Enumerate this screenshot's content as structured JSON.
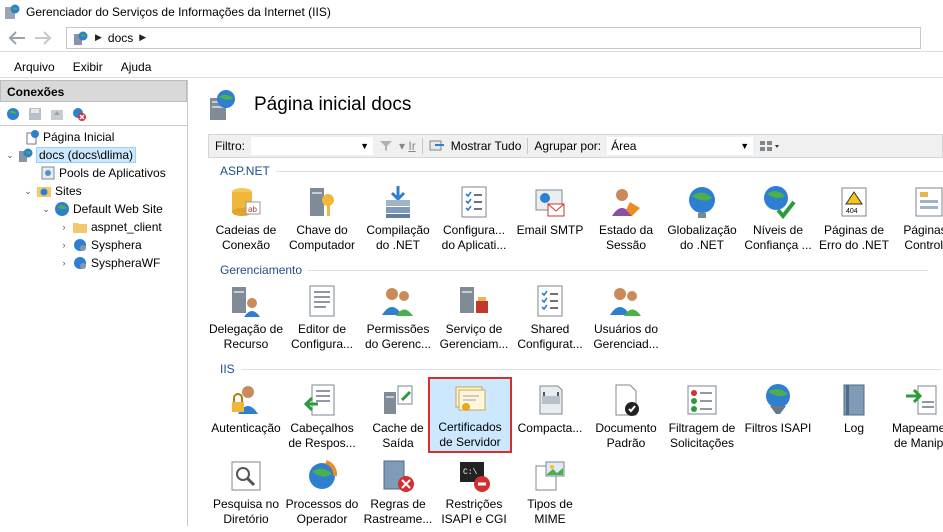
{
  "window": {
    "title": "Gerenciador do Serviços de Informações da Internet (IIS)"
  },
  "address": {
    "crumbs": [
      "docs"
    ]
  },
  "menu": {
    "items": [
      "Arquivo",
      "Exibir",
      "Ajuda"
    ]
  },
  "connections": {
    "title": "Conexões",
    "tree": [
      {
        "label": "Página Inicial"
      },
      {
        "label": "docs (docs\\dlima)"
      },
      {
        "label": "Pools de Aplicativos"
      },
      {
        "label": "Sites"
      },
      {
        "label": "Default Web Site"
      },
      {
        "label": "aspnet_client"
      },
      {
        "label": "Sysphera"
      },
      {
        "label": "SyspheraWF"
      }
    ]
  },
  "main": {
    "title": "Página inicial docs",
    "filter": {
      "label": "Filtro:",
      "go": "Ir",
      "show_all": "Mostrar Tudo",
      "group_by": "Agrupar por:",
      "group_value": "Área"
    },
    "groups": [
      {
        "name": "ASP.NET",
        "features": [
          "Cadeias de\nConexão",
          "Chave do\nComputador",
          "Compilação\ndo .NET",
          "Configura...\ndo Aplicati...",
          "Email SMTP",
          "Estado da\nSessão",
          "Globalização\ndo .NET",
          "Níveis de\nConfiança ...",
          "Páginas de\nErro do .NET",
          "Páginas e\nControles"
        ]
      },
      {
        "name": "Gerenciamento",
        "features": [
          "Delegação de\nRecurso",
          "Editor de\nConfigura...",
          "Permissões\ndo Gerenc...",
          "Serviço de\nGerenciam...",
          "Shared\nConfigurat...",
          "Usuários do\nGerenciad..."
        ]
      },
      {
        "name": "IIS",
        "features": [
          "Autenticação",
          "Cabeçalhos\nde Respos...",
          "Cache de\nSaída",
          "Certificados\nde Servidor",
          "Compacta...",
          "Documento\nPadrão",
          "Filtragem de\nSolicitações",
          "Filtros ISAPI",
          "Log",
          "Mapeamen\nde Manipu",
          "Pesquisa no\nDiretório",
          "Processos do\nOperador",
          "Regras de\nRastreame...",
          "Restrições\nISAPI e CGI",
          "Tipos de\nMIME"
        ]
      }
    ]
  }
}
